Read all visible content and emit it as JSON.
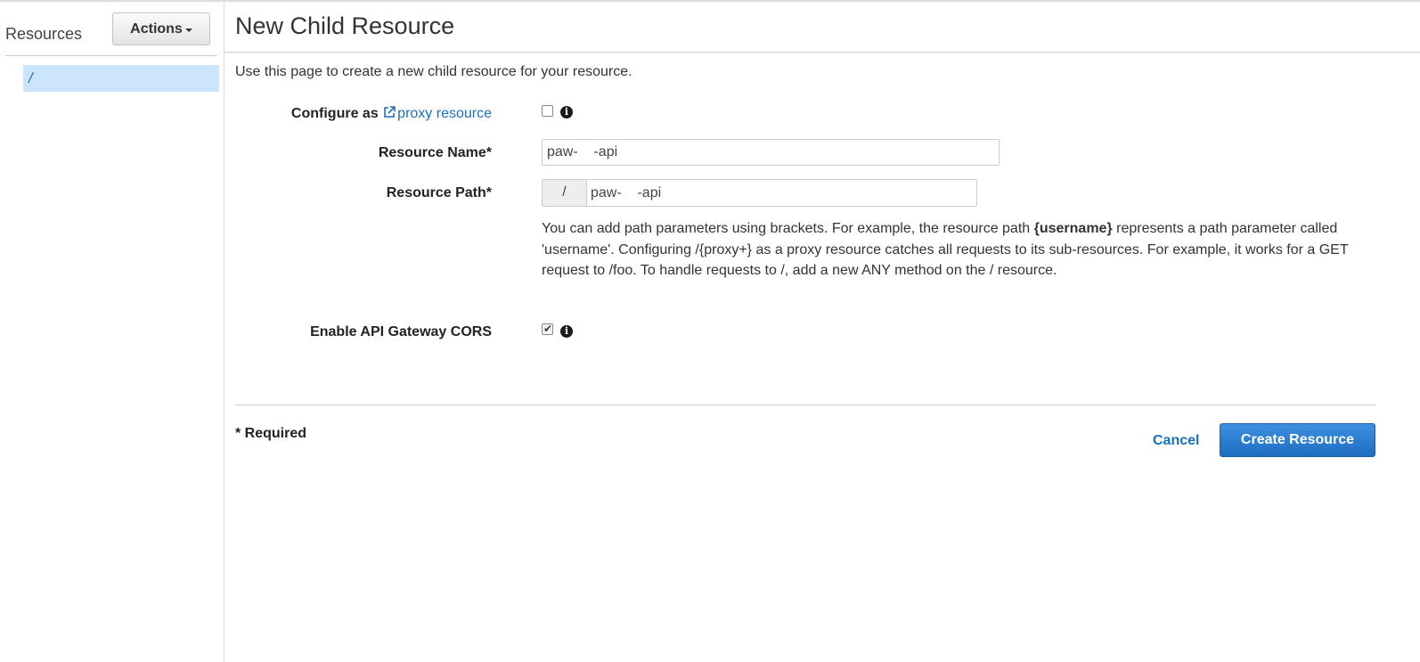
{
  "sidebar": {
    "title": "Resources",
    "actions_label": "Actions",
    "tree": [
      {
        "label": "/"
      }
    ]
  },
  "main": {
    "title": "New Child Resource",
    "intro": "Use this page to create a new child resource for your resource.",
    "proxy": {
      "label": "Configure as",
      "link_text": "proxy resource",
      "checked": false
    },
    "resource_name": {
      "label": "Resource Name*",
      "value": "paw-    -api"
    },
    "resource_path": {
      "label": "Resource Path*",
      "prefix": "/",
      "value": "paw-    -api"
    },
    "help": {
      "part1": "You can add path parameters using brackets. For example, the resource path ",
      "bold": "{username}",
      "part2": " represents a path parameter called 'username'. Configuring /{proxy+} as a proxy resource catches all requests to its sub-resources. For example, it works for a GET request to /foo. To handle requests to /, add a new ANY method on the / resource."
    },
    "cors": {
      "label": "Enable API Gateway CORS",
      "checked": true
    },
    "required_note": "* Required",
    "cancel_label": "Cancel",
    "create_label": "Create Resource"
  },
  "icons": {
    "info": "info-icon",
    "external_link": "external-link-icon",
    "caret": "caret-down-icon",
    "check": "checkmark-icon"
  },
  "colors": {
    "link": "#1a6fbf",
    "primary_button": "#1f6dc2",
    "selected_row": "#cce5fc"
  }
}
